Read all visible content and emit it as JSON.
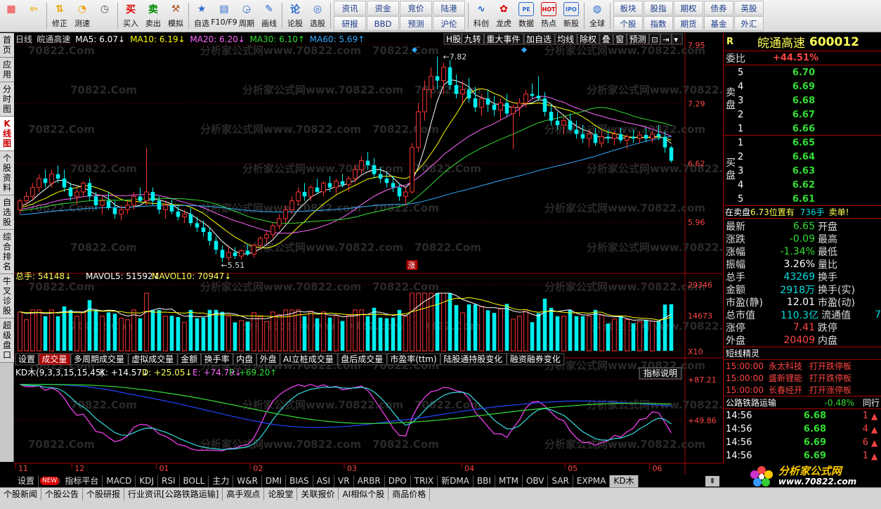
{
  "toolbar": {
    "buttons": [
      {
        "label": "",
        "icon": "grid-icon"
      },
      {
        "label": "",
        "icon": "back-arrow-icon"
      },
      {
        "label": "修正",
        "icon": "up-down-icon"
      },
      {
        "label": "测速",
        "icon": "gauge-icon"
      },
      {
        "label": "",
        "icon": "clock-icon"
      },
      {
        "label": "买入",
        "icon": "buy-icon",
        "glyph": "买"
      },
      {
        "label": "卖出",
        "icon": "sell-icon",
        "glyph": "卖"
      },
      {
        "label": "模拟",
        "icon": "hammer-icon"
      },
      {
        "label": "自选",
        "icon": "star-icon"
      },
      {
        "label": "F10/F9",
        "icon": "f10-icon"
      },
      {
        "label": "周期",
        "icon": "period-icon"
      },
      {
        "label": "画线",
        "icon": "pencil-icon"
      },
      {
        "label": "论股",
        "icon": "forum-icon"
      },
      {
        "label": "选股",
        "icon": "select-stock-icon"
      }
    ],
    "grid1": [
      "资讯",
      "资金",
      "竞价",
      "陆港",
      "研报",
      "BBD",
      "预测",
      "沪伦"
    ],
    "buttons2": [
      {
        "label": "科创",
        "icon": "sci-tech-icon"
      },
      {
        "label": "龙虎",
        "icon": "dragon-tiger-icon"
      },
      {
        "label": "数据",
        "icon": "pe-data-icon",
        "glyph": "PE"
      },
      {
        "label": "热点",
        "icon": "hot-icon",
        "glyph": "HOT"
      },
      {
        "label": "新股",
        "icon": "ipo-icon",
        "glyph": "IPO"
      },
      {
        "label": "全球",
        "icon": "globe-icon"
      }
    ],
    "grid2": [
      "板块",
      "股指",
      "期权",
      "债券",
      "英股",
      "个股",
      "指数",
      "期货",
      "基金",
      "外汇"
    ]
  },
  "left_tabs": [
    "首页",
    "应用",
    "分时图",
    "K线图",
    "个股资料",
    "自选股",
    "综合排名",
    "牛叉诊股",
    "超级盘口"
  ],
  "left_tab_active": 3,
  "chart_header": {
    "period": "日线",
    "name": "皖通高速",
    "ma5": "MA5: 6.07↓",
    "ma10": "MA10: 6.19↓",
    "ma20": "MA20: 6.20↓",
    "ma30": "MA30: 6.10↑",
    "ma60": "MA60: 5.69↑",
    "menu": [
      "H股",
      "九转",
      "重大事件",
      "加自选",
      "均线",
      "除权",
      "叠",
      "窗",
      "预测"
    ]
  },
  "price_axis": [
    "7.95",
    "7.29",
    "6.62",
    "5.96"
  ],
  "annot_high": "7.82",
  "annot_low": "5.51",
  "zhang_label": "涨",
  "volume_header": {
    "total": "总手: 54148↓",
    "mavol5": "MAVOL5: 51592↓",
    "mavol10": "MAVOL10: 70947↓"
  },
  "volume_axis": [
    "29346",
    "14673",
    "X10"
  ],
  "vol_tabs": [
    "设置",
    "成交量",
    "多周期成交量",
    "虚拟成交量",
    "金额",
    "换手率",
    "内盘",
    "外盘",
    "AI立桩成交量",
    "盘后成交量",
    "市盈率(ttm)",
    "陆股通持股变化",
    "融资融券变化"
  ],
  "vol_tab_active": 1,
  "kd_header": {
    "name": "KD木(9,3,3,15,15,45)",
    "k": "K: +14.57↓",
    "d": "D: +25.05↓",
    "e": "E: +74.79↓",
    "f": "F: +69.20↑"
  },
  "kd_button": "指标说明",
  "kd_axis": [
    "+87.21",
    "+49.86"
  ],
  "month_axis": [
    "11",
    "12",
    "01",
    "02",
    "03",
    "04",
    "05",
    "06"
  ],
  "indicator_tabs": [
    "设置",
    "NEW",
    "指标平台",
    "MACD",
    "KDJ",
    "RSI",
    "BOLL",
    "主力",
    "W&R",
    "DMI",
    "BIAS",
    "ASI",
    "VR",
    "ARBR",
    "DPO",
    "TRIX",
    "新DMA",
    "BBI",
    "MTM",
    "OBV",
    "SAR",
    "EXPMA",
    "KD木"
  ],
  "indicator_active": 22,
  "bottom_tabs": [
    "个股新闻",
    "个股公告",
    "个股研报",
    "行业资讯[公路铁路运输]",
    "高手观点",
    "论股堂",
    "关联报价",
    "AI相似个股",
    "商品价格"
  ],
  "watermark": "分析家公式网www.70822.com",
  "watermark2": "70822.Com",
  "right": {
    "code_prefix": "R",
    "stock_name": "皖通高速",
    "stock_code": "600012",
    "weibi_label": "委比",
    "weibi_value": "+44.51%",
    "sell_label": "卖盘",
    "buy_label": "买盘",
    "asks": [
      {
        "lvl": "5",
        "price": "6.70"
      },
      {
        "lvl": "4",
        "price": "6.69"
      },
      {
        "lvl": "3",
        "price": "6.68"
      },
      {
        "lvl": "2",
        "price": "6.67"
      },
      {
        "lvl": "1",
        "price": "6.66"
      }
    ],
    "bids": [
      {
        "lvl": "1",
        "price": "6.65"
      },
      {
        "lvl": "2",
        "price": "6.64"
      },
      {
        "lvl": "3",
        "price": "6.63"
      },
      {
        "lvl": "4",
        "price": "6.62"
      },
      {
        "lvl": "5",
        "price": "6.61"
      }
    ],
    "sell_note_1": "在卖盘",
    "sell_note_2": "6.73位置有",
    "sell_note_3": "736手",
    "sell_note_4": "卖单!",
    "stats": [
      {
        "k": "最新",
        "v": "6.65",
        "c": "#33dd33",
        "k2": "开盘"
      },
      {
        "k": "涨跌",
        "v": "-0.09",
        "c": "#33dd33",
        "k2": "最高"
      },
      {
        "k": "涨幅",
        "v": "-1.34%",
        "c": "#33dd33",
        "k2": "最低"
      },
      {
        "k": "振幅",
        "v": "3.26%",
        "c": "#ffffff",
        "k2": "量比"
      },
      {
        "k": "总手",
        "v": "43269",
        "c": "#00dddd",
        "k2": "换手"
      },
      {
        "k": "金额",
        "v": "2918万",
        "c": "#00dddd",
        "k2": "换手(实)"
      },
      {
        "k": "市盈(静)",
        "v": "12.01",
        "c": "#ffffff",
        "k2": "市盈(动)"
      },
      {
        "k": "总市值",
        "v": "110.3亿",
        "c": "#00dddd",
        "k2": "流通值"
      },
      {
        "k": "涨停",
        "v": "7.41",
        "c": "#ff4444",
        "k2": "跌停"
      },
      {
        "k": "外盘",
        "v": "20409",
        "c": "#ff4444",
        "k2": "内盘"
      }
    ],
    "stats_tail": "7",
    "sprite_title": "短线精灵",
    "sprite": [
      {
        "time": "15:00:00",
        "name": "永太科技",
        "event": "打开跌停板"
      },
      {
        "time": "15:00:00",
        "name": "盛新锂能",
        "event": "打开跌停板"
      },
      {
        "time": "15:00:00",
        "name": "长春经开",
        "event": "打开涨停板"
      }
    ],
    "industry_name": "公路铁路运输",
    "industry_change": "-0.48%",
    "industry_peer": "同行",
    "ticks": [
      {
        "time": "14:56",
        "price": "6.68",
        "vol": "1",
        "dir": "up"
      },
      {
        "time": "14:56",
        "price": "6.68",
        "vol": "4",
        "dir": "up"
      },
      {
        "time": "14:56",
        "price": "6.69",
        "vol": "6",
        "dir": "up"
      },
      {
        "time": "14:56",
        "price": "6.69",
        "vol": "1",
        "dir": "up"
      }
    ]
  },
  "logo": {
    "title": "分析家公式网",
    "url": "www.70822.com"
  },
  "chart_data": {
    "type": "candlestick",
    "ylim": [
      5.4,
      7.95
    ],
    "candles": [
      [
        6.1,
        6.22,
        6.05,
        6.2
      ],
      [
        6.2,
        6.3,
        6.15,
        6.25
      ],
      [
        6.25,
        6.4,
        6.2,
        6.35
      ],
      [
        6.35,
        6.5,
        6.3,
        6.45
      ],
      [
        6.45,
        6.55,
        6.35,
        6.4
      ],
      [
        6.4,
        6.55,
        6.35,
        6.5
      ],
      [
        6.5,
        6.6,
        6.4,
        6.45
      ],
      [
        6.45,
        6.55,
        6.3,
        6.35
      ],
      [
        6.35,
        6.4,
        6.2,
        6.25
      ],
      [
        6.25,
        6.35,
        6.15,
        6.3
      ],
      [
        6.3,
        6.42,
        6.25,
        6.4
      ],
      [
        6.4,
        6.45,
        6.2,
        6.25
      ],
      [
        6.25,
        6.3,
        6.1,
        6.15
      ],
      [
        6.15,
        6.25,
        6.05,
        6.2
      ],
      [
        6.2,
        6.3,
        6.1,
        6.12
      ],
      [
        6.12,
        6.2,
        6.0,
        6.05
      ],
      [
        6.05,
        6.15,
        5.98,
        6.1
      ],
      [
        6.1,
        6.2,
        6.05,
        6.15
      ],
      [
        6.15,
        6.3,
        6.1,
        6.25
      ],
      [
        6.25,
        6.35,
        6.18,
        6.2
      ],
      [
        6.2,
        6.8,
        6.15,
        6.3
      ],
      [
        6.3,
        6.35,
        6.15,
        6.2
      ],
      [
        6.2,
        6.25,
        6.05,
        6.1
      ],
      [
        6.1,
        6.2,
        6.0,
        6.15
      ],
      [
        6.15,
        6.22,
        6.05,
        6.08
      ],
      [
        6.08,
        6.15,
        5.98,
        6.02
      ],
      [
        6.02,
        6.1,
        5.95,
        6.05
      ],
      [
        6.05,
        6.12,
        5.92,
        5.95
      ],
      [
        5.95,
        6.02,
        5.85,
        5.9
      ],
      [
        5.9,
        5.98,
        5.8,
        5.85
      ],
      [
        5.85,
        5.9,
        5.7,
        5.75
      ],
      [
        5.75,
        5.8,
        5.6,
        5.65
      ],
      [
        5.65,
        5.7,
        5.51,
        5.56
      ],
      [
        5.56,
        5.7,
        5.52,
        5.62
      ],
      [
        5.62,
        5.68,
        5.55,
        5.58
      ],
      [
        5.58,
        5.66,
        5.54,
        5.64
      ],
      [
        5.64,
        5.72,
        5.58,
        5.6
      ],
      [
        5.6,
        5.72,
        5.56,
        5.7
      ],
      [
        5.7,
        5.8,
        5.66,
        5.78
      ],
      [
        5.78,
        5.86,
        5.72,
        5.82
      ],
      [
        5.82,
        5.95,
        5.78,
        5.92
      ],
      [
        5.92,
        6.05,
        5.88,
        6.0
      ],
      [
        6.0,
        6.15,
        5.95,
        6.1
      ],
      [
        6.1,
        6.25,
        6.05,
        6.2
      ],
      [
        6.2,
        6.35,
        6.15,
        6.3
      ],
      [
        6.3,
        6.4,
        6.2,
        6.25
      ],
      [
        6.25,
        6.38,
        6.2,
        6.35
      ],
      [
        6.35,
        6.45,
        6.28,
        6.3
      ],
      [
        6.3,
        6.42,
        6.25,
        6.4
      ],
      [
        6.4,
        6.48,
        6.3,
        6.35
      ],
      [
        6.35,
        6.45,
        6.28,
        6.42
      ],
      [
        6.42,
        6.5,
        6.35,
        6.38
      ],
      [
        6.38,
        6.48,
        6.3,
        6.45
      ],
      [
        6.45,
        6.6,
        6.4,
        6.55
      ],
      [
        6.55,
        6.7,
        6.5,
        6.65
      ],
      [
        6.65,
        6.75,
        6.55,
        6.6
      ],
      [
        6.6,
        6.68,
        6.45,
        6.5
      ],
      [
        6.5,
        6.58,
        6.4,
        6.45
      ],
      [
        6.45,
        6.52,
        6.35,
        6.4
      ],
      [
        6.4,
        6.48,
        6.3,
        6.35
      ],
      [
        6.35,
        6.4,
        6.2,
        6.25
      ],
      [
        6.25,
        6.35,
        6.15,
        6.3
      ],
      [
        6.3,
        6.85,
        6.28,
        6.8
      ],
      [
        6.8,
        7.3,
        6.75,
        7.2
      ],
      [
        7.2,
        7.55,
        7.1,
        7.45
      ],
      [
        7.45,
        7.7,
        7.35,
        7.6
      ],
      [
        7.6,
        7.82,
        7.45,
        7.55
      ],
      [
        7.55,
        7.75,
        7.4,
        7.7
      ],
      [
        7.7,
        7.78,
        7.45,
        7.5
      ],
      [
        7.5,
        7.62,
        7.35,
        7.4
      ],
      [
        7.4,
        7.55,
        7.3,
        7.45
      ],
      [
        7.45,
        7.58,
        7.3,
        7.35
      ],
      [
        7.35,
        7.48,
        7.2,
        7.25
      ],
      [
        7.25,
        7.4,
        7.15,
        7.35
      ],
      [
        7.35,
        7.45,
        7.2,
        7.28
      ],
      [
        7.28,
        7.38,
        7.15,
        7.22
      ],
      [
        7.22,
        7.35,
        7.1,
        7.3
      ],
      [
        7.3,
        7.4,
        7.15,
        7.18
      ],
      [
        7.18,
        7.28,
        6.78,
        7.25
      ],
      [
        7.25,
        7.35,
        7.15,
        7.3
      ],
      [
        7.3,
        7.45,
        7.25,
        7.4
      ],
      [
        7.4,
        7.52,
        7.35,
        7.38
      ],
      [
        7.38,
        7.6,
        7.32,
        7.35
      ],
      [
        7.35,
        7.42,
        7.15,
        7.2
      ],
      [
        7.2,
        7.28,
        7.05,
        7.1
      ],
      [
        7.1,
        7.2,
        7.0,
        7.05
      ],
      [
        7.05,
        7.15,
        6.95,
        7.1
      ],
      [
        7.1,
        7.18,
        6.98,
        7.0
      ],
      [
        7.0,
        7.1,
        6.9,
        6.95
      ],
      [
        6.95,
        7.05,
        6.85,
        6.9
      ],
      [
        6.9,
        7.0,
        6.8,
        6.95
      ],
      [
        6.95,
        7.02,
        6.82,
        6.85
      ],
      [
        6.85,
        6.98,
        6.8,
        6.92
      ],
      [
        6.92,
        7.0,
        6.85,
        6.9
      ],
      [
        6.9,
        6.98,
        6.82,
        6.95
      ],
      [
        6.95,
        7.02,
        6.85,
        6.88
      ],
      [
        6.88,
        6.95,
        6.78,
        6.92
      ],
      [
        6.92,
        7.0,
        6.85,
        6.9
      ],
      [
        6.9,
        6.98,
        6.84,
        6.94
      ],
      [
        6.94,
        7.02,
        6.86,
        6.9
      ],
      [
        6.9,
        6.98,
        6.85,
        6.95
      ],
      [
        6.95,
        7.05,
        6.88,
        6.92
      ],
      [
        6.92,
        6.98,
        6.74,
        6.8
      ],
      [
        6.8,
        6.82,
        6.63,
        6.65
      ]
    ],
    "ma_labels": [
      "MA5",
      "MA10",
      "MA20",
      "MA30",
      "MA60"
    ]
  }
}
